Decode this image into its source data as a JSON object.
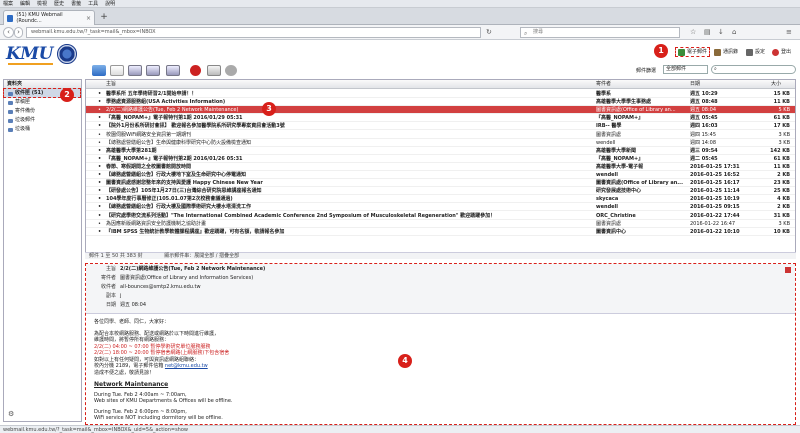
{
  "browser": {
    "menu": [
      "檔案",
      "編輯",
      "檢視",
      "歷史",
      "書籤",
      "工具",
      "說明"
    ],
    "tab_title": "(51) KMU Webmail (Roundc...",
    "url": "webmail.kmu.edu.tw/?_task=mail&_mbox=INBOX",
    "search_placeholder": "搜尋",
    "status": "webmail.kmu.edu.tw/?_task=mail&_mbox=INBOX&_uid=5&_action=show"
  },
  "header": {
    "logo": "KMU",
    "buttons": [
      "電子郵件",
      "通訊錄",
      "設定",
      "登出"
    ]
  },
  "toolbar": {
    "filter_label": "郵件篩選",
    "filter_value": "全部郵件"
  },
  "folders": {
    "title": "資料夾",
    "items": [
      {
        "label": "收件匣 (51)",
        "selected": true
      },
      {
        "label": "草稿匣",
        "selected": false
      },
      {
        "label": "寄件備份",
        "selected": false
      },
      {
        "label": "垃圾郵件",
        "selected": false
      },
      {
        "label": "垃圾桶",
        "selected": false
      }
    ]
  },
  "list": {
    "col_subject": "主旨",
    "col_from": "寄件者",
    "col_date": "日期",
    "col_size": "大小",
    "rows": [
      {
        "subject": "醫學系所 五年學術研習2/1開始申請！！",
        "from": "醫學系",
        "date": "週五 10:29",
        "size": "15 KB",
        "unread": true
      },
      {
        "subject": "學務處資源服務組(USA Activities Information)",
        "from": "高雄醫學大學學生事務處",
        "date": "週五 08:48",
        "size": "11 KB",
        "unread": true
      },
      {
        "subject": "2/2(二)網路維護公告(Tue, Feb 2 Network Maintenance)",
        "from": "圖書資訊處(Office of Library an...",
        "date": "週五 08:04",
        "size": "5 KB",
        "unread": false,
        "selected": true
      },
      {
        "subject": "『高醫_NOPAM+』電子報特刊第1期 2016/01/29 05:31",
        "from": "『高醫_NOPAM+』",
        "date": "週五 05:45",
        "size": "61 KB",
        "unread": true
      },
      {
        "subject": "【院外1月份系所研討會訊】 歡迎報名參加醫學院系所研究學專案資訊會活動3號",
        "from": "IRB-- 醫學",
        "date": "週四 16:03",
        "size": "17 KB",
        "unread": true
      },
      {
        "subject": "校園伺服WiFi網路安全資訊第一期期刊",
        "from": "圖書資訊處",
        "date": "週四 15:45",
        "size": "3 KB",
        "unread": false
      },
      {
        "subject": "【總務處營繕組公告】生命與健康科學研究中心防火設備檢查通知",
        "from": "wendell",
        "date": "週四 14:08",
        "size": "3 KB",
        "unread": false
      },
      {
        "subject": "高雄醫學大學第281期",
        "from": "高雄醫學大學新聞",
        "date": "週三 09:54",
        "size": "142 KB",
        "unread": true
      },
      {
        "subject": "『高醫_NOPAM+』電子報特刊第2期 2016/01/26 05:31",
        "from": "『高醫_NOPAM+』",
        "date": "週二 05:45",
        "size": "61 KB",
        "unread": true
      },
      {
        "subject": "春節、寒假期間之全校圖書館開放時間",
        "from": "高雄醫學大學-電子報",
        "date": "2016-01-25 17:31",
        "size": "11 KB",
        "unread": true
      },
      {
        "subject": "【總務處營繕組公告】行政大樓地下室及生命研究中心停電通知",
        "from": "wendell",
        "date": "2016-01-25 16:52",
        "size": "2 KB",
        "unread": true
      },
      {
        "subject": "圖書資訊處感謝您整年來的支持與愛護 Happy Chinese New Year",
        "from": "圖書資訊處(Office of Library an...",
        "date": "2016-01-25 16:17",
        "size": "23 KB",
        "unread": true
      },
      {
        "subject": "【研發處公告】105年1月27日(三)台灣綜合研究院思維講座報名通知",
        "from": "研究發展處技術中心",
        "date": "2016-01-25 11:14",
        "size": "25 KB",
        "unread": true
      },
      {
        "subject": "104學年度行事曆修正(105.01.07第2次校務會議通過)",
        "from": "skycaca",
        "date": "2016-01-25 10:19",
        "size": "4 KB",
        "unread": true
      },
      {
        "subject": "【總務處營繕組公告】行政大樓及國際學術研究大樓水塔清洗工作",
        "from": "wendell",
        "date": "2016-01-25 09:15",
        "size": "2 KB",
        "unread": true
      },
      {
        "subject": "【研究處學術交流系列活動】\"The International Combined Academic Conference 2nd Symposium of Musculoskeletal Regeneration\" 歡迎踴躍參加！",
        "from": "ORC_Christine",
        "date": "2016-01-22 17:44",
        "size": "31 KB",
        "unread": true
      },
      {
        "subject": "為因應新版網路資訊安全防護機制之協助計畫",
        "from": "圖書資訊處",
        "date": "2016-01-22 16:47",
        "size": "3 KB",
        "unread": false
      },
      {
        "subject": "『IBM SPSS 生物統計教學軟體課程講座』歡迎踴躍，可有名額，敬請報名參加",
        "from": "圖書資訊中心",
        "date": "2016-01-22 10:10",
        "size": "10 KB",
        "unread": true
      }
    ],
    "footer": "郵件 1 至 50 共 383 封",
    "threads_label": "顯示郵件串：展開全部 / 摺疊全部"
  },
  "preview": {
    "subject_label": "主旨",
    "subject": "2/2(二)網路維護公告(Tue, Feb 2 Network Maintenance)",
    "from_label": "寄件者",
    "from": "圖書資訊處(Office of Library and Information Services)",
    "to_label": "收件者",
    "to": "all-bounces@smtp2.kmu.edu.tw",
    "cc_label": "副本",
    "cc": "j",
    "date_label": "日期",
    "date": "週五 08:04",
    "greeting": "各位同學、老師、同仁，大家好：",
    "body_lines": [
      "為配合本校網路服務、配送或網路於以下時間進行維護，",
      "維護時間，將暫停所有網路服務："
    ],
    "red_lines": [
      "2/2(二) 04:00 ~ 07:00 暫停學術研究單位服務服務",
      "2/2(二) 18:00 ~ 20:00 暫停宿舍網路(上網服務)下包含宿舍"
    ],
    "notes": [
      "如對以上有任何疑問，可與資訊處網路組聯絡：",
      "校內分機 2189，電子郵件信箱"
    ],
    "email_link": "net@kmu.edu.tw",
    "thanks": "造成不便之處，敬請見諒！",
    "en_heading": "Network Maintenance",
    "en_lines": [
      "During Tue. Feb 2 4:00am ~ 7:00am,",
      "Web sites of KMU Departments & Offices will be offline.",
      "",
      "During Tue. Feb 2 6:00pm ~ 8:00pm,",
      "WiFi service NOT including dormitory will be offline."
    ]
  },
  "annotations": [
    "1",
    "2",
    "3",
    "4"
  ],
  "colors": {
    "badge": "#d8201a",
    "selected_row": "#d24040",
    "brand": "#1a4aa6"
  }
}
